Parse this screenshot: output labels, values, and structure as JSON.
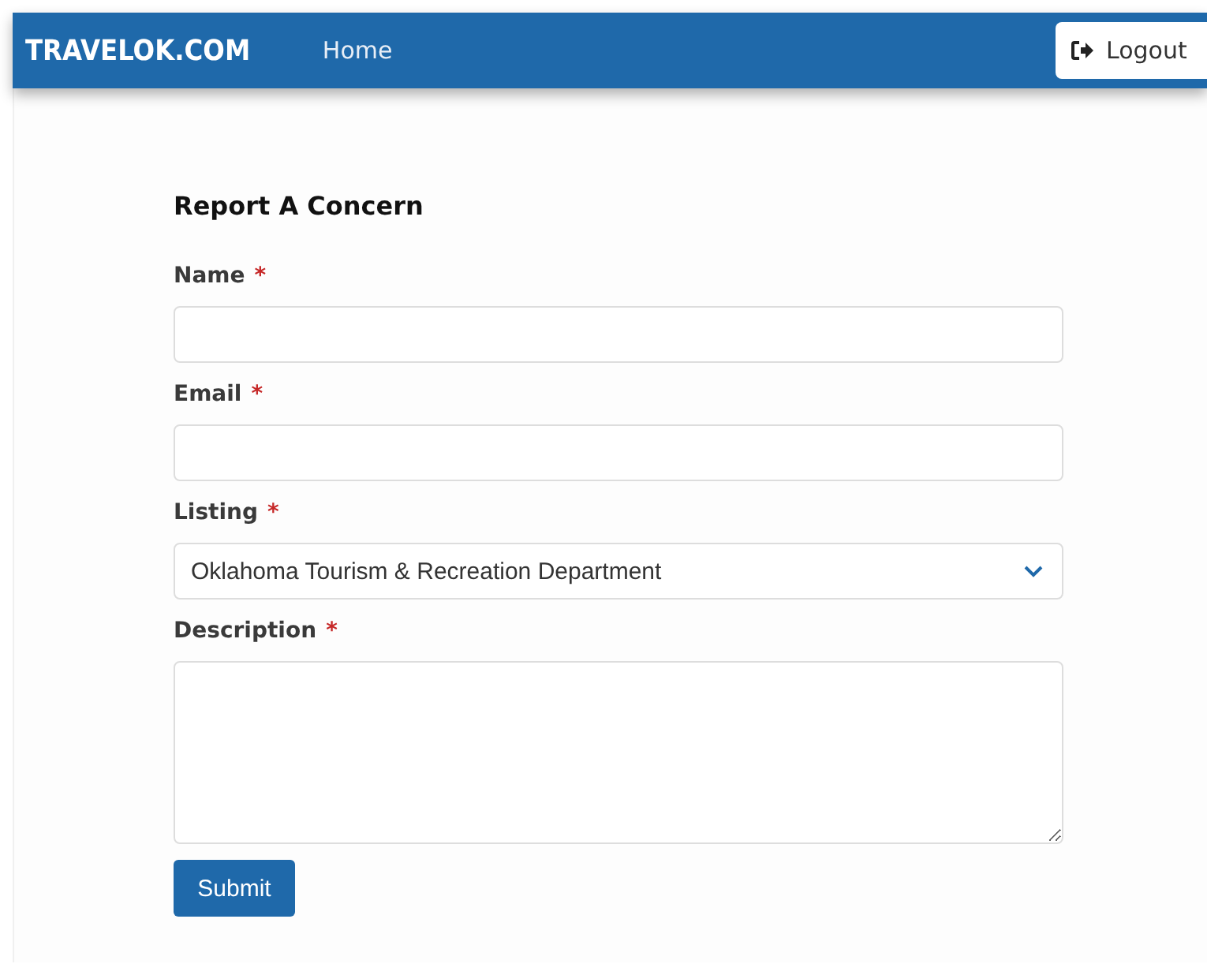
{
  "navbar": {
    "brand": "TRAVELOK.COM",
    "links": [
      "Home"
    ],
    "logout": "Logout"
  },
  "form": {
    "title": "Report A Concern",
    "fields": [
      {
        "kind": "text",
        "label": "Name",
        "required_mark": "*"
      },
      {
        "kind": "text",
        "label": "Email",
        "required_mark": "*"
      },
      {
        "kind": "select",
        "label": "Listing",
        "required_mark": "*",
        "value": "Oklahoma Tourism & Recreation Department"
      },
      {
        "kind": "textarea",
        "label": "Description",
        "required_mark": "*"
      }
    ],
    "submit": "Submit"
  }
}
